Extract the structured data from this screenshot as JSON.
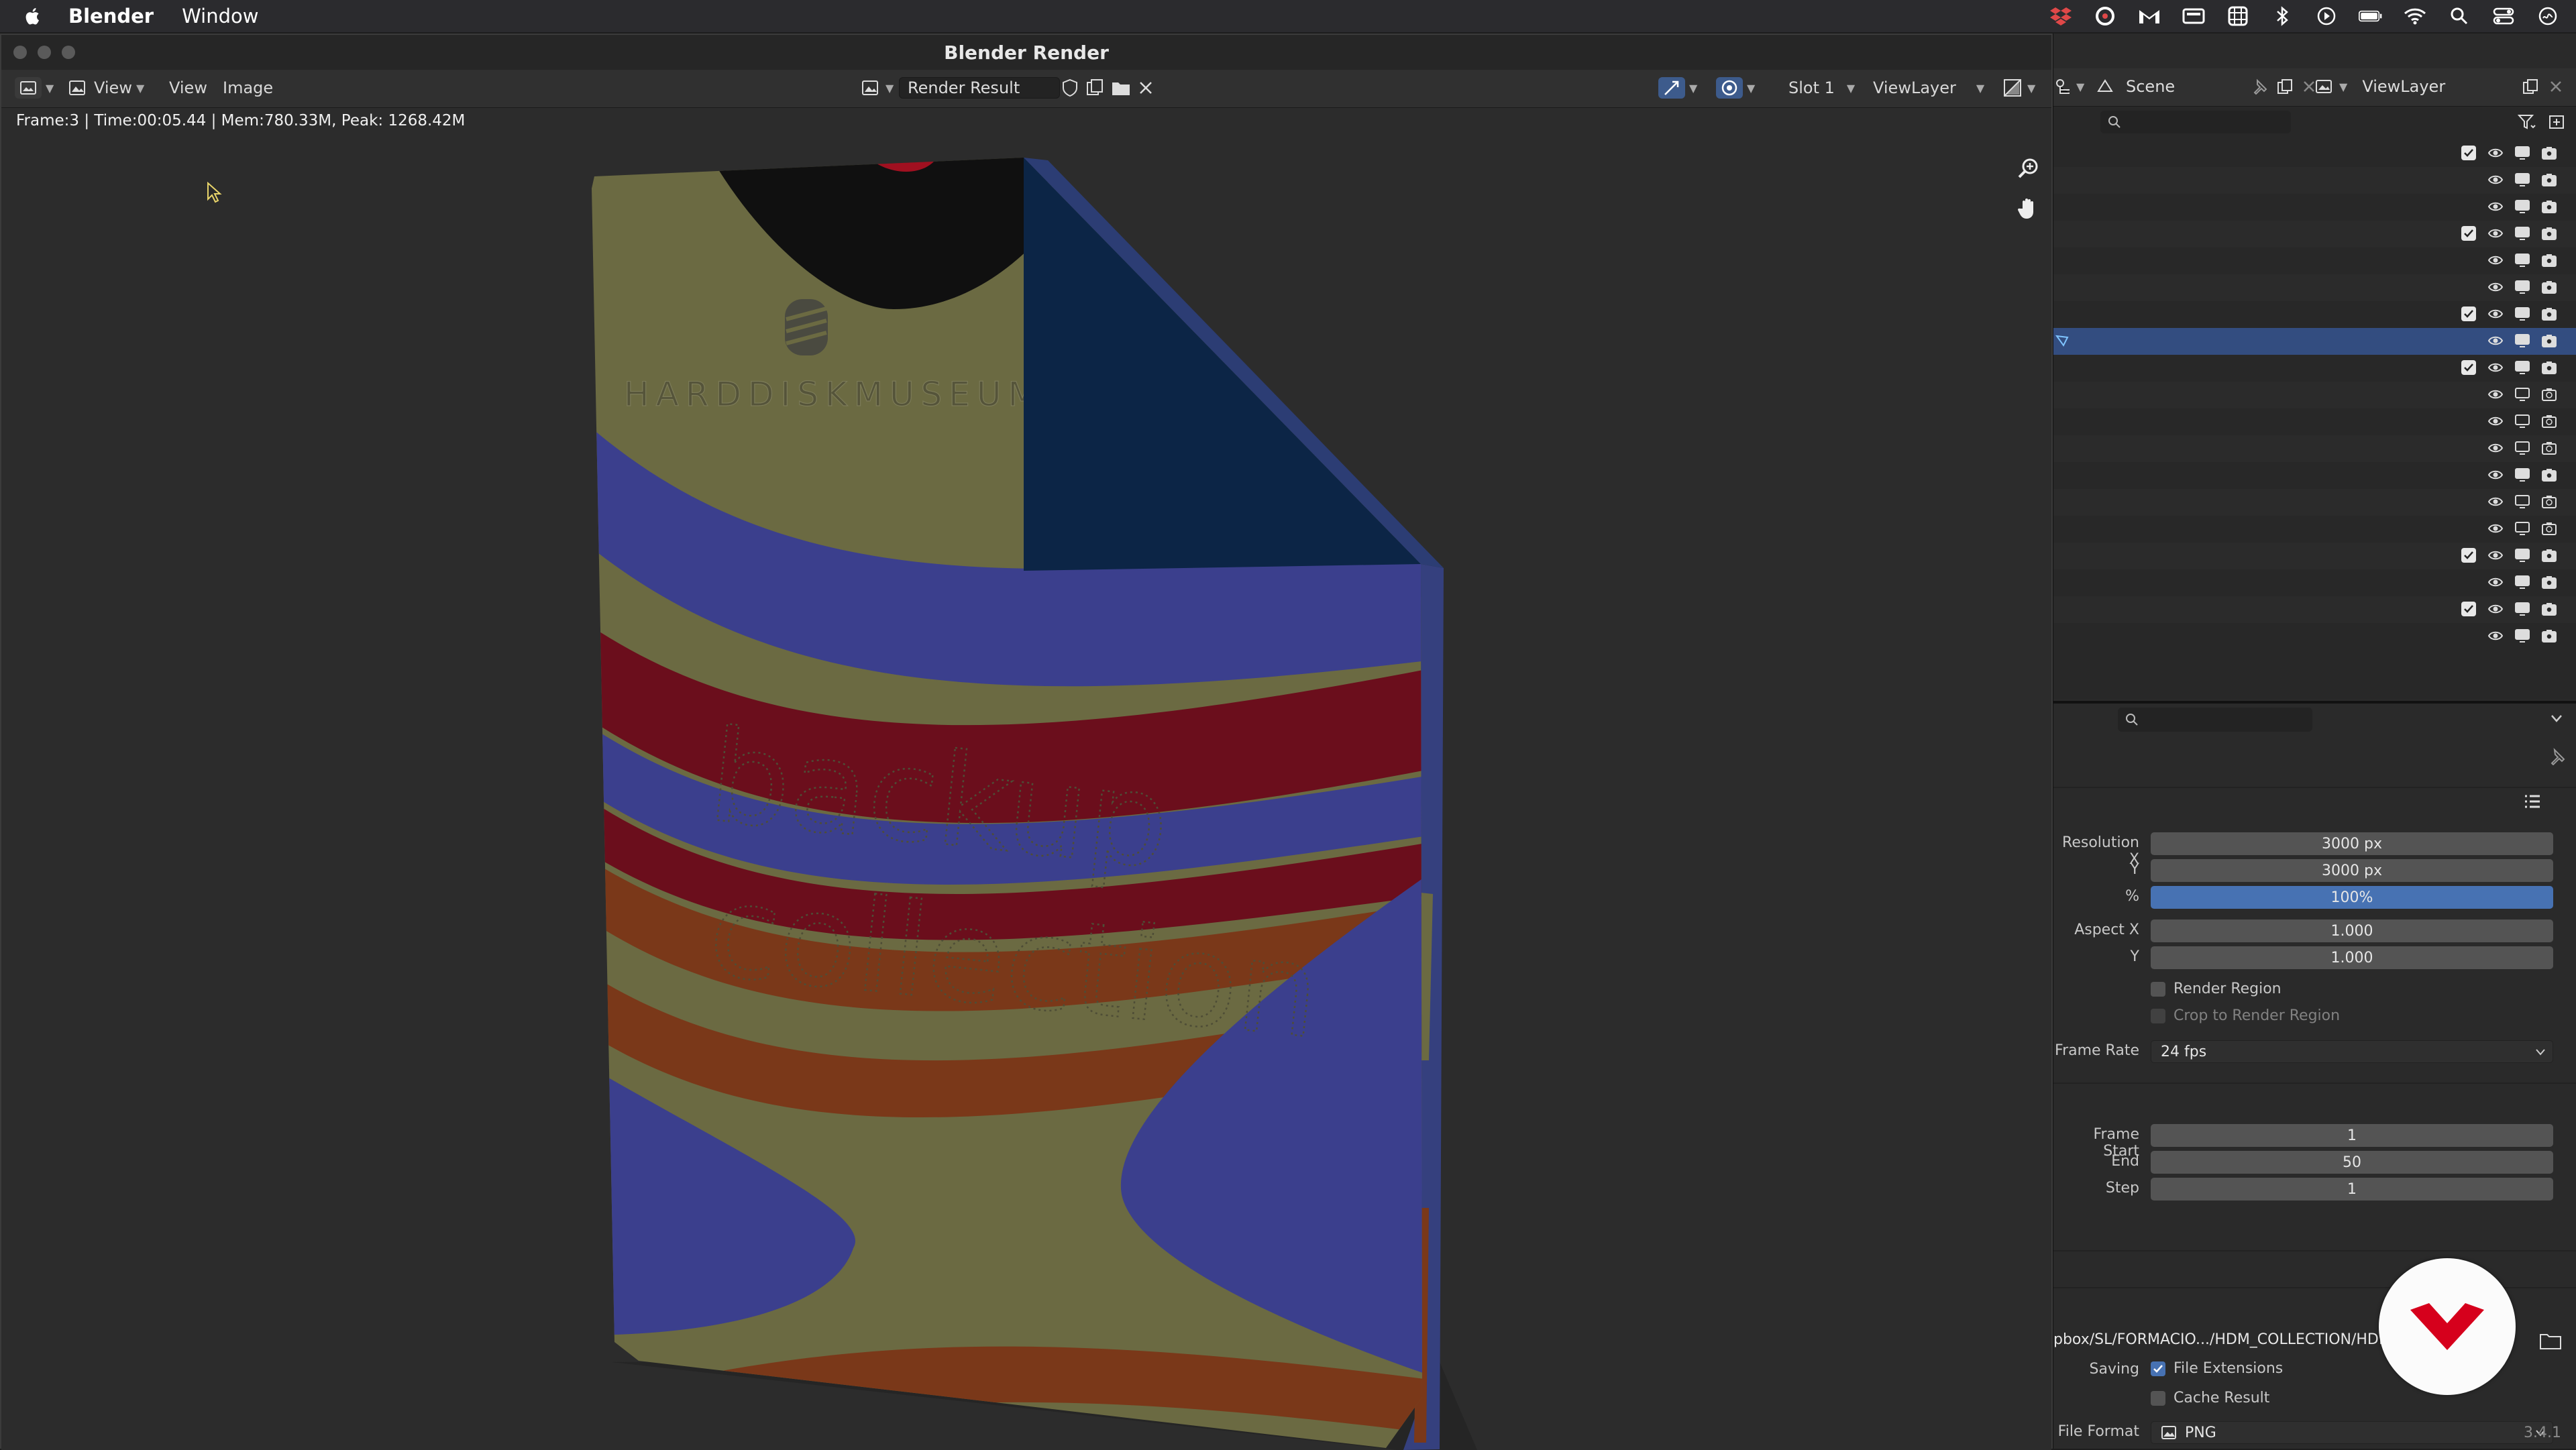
{
  "menubar": {
    "app_name": "Blender",
    "items": [
      "Window"
    ],
    "tray_icons": [
      "dropbox-icon",
      "creative-cloud-icon",
      "gmail-icon",
      "drive-icon",
      "grid-icon",
      "bluetooth-icon",
      "play-icon",
      "battery-icon",
      "wifi-icon",
      "search-icon",
      "control-center-icon",
      "siri-icon"
    ]
  },
  "window": {
    "title": "Blender Render"
  },
  "image_editor": {
    "menus": [
      "View",
      "View",
      "Image"
    ],
    "image_name": "Render Result",
    "slot": "Slot 1",
    "view_layer": "ViewLayer",
    "stats": "Frame:3 | Time:00:05.44 | Mem:780.33M, Peak: 1268.42M"
  },
  "render": {
    "brand_text": "HARDDISKMUSEUM",
    "line1": "backup",
    "line2": "collection",
    "colors": {
      "olive": "#6b6a42",
      "blue": "#3b3f8d",
      "red": "#6b0e1c",
      "orange": "#7a3819",
      "dark_blue": "#0c2546",
      "black": "#101010"
    }
  },
  "outliner": {
    "scene": "Scene",
    "view_layer": "ViewLayer",
    "rows": [
      {
        "checked": true,
        "selected": false,
        "dim": false
      },
      {
        "checked": false,
        "selected": false,
        "dim": false
      },
      {
        "checked": false,
        "selected": false,
        "dim": false
      },
      {
        "checked": true,
        "selected": false,
        "dim": false
      },
      {
        "checked": false,
        "selected": false,
        "dim": false
      },
      {
        "checked": false,
        "selected": false,
        "dim": false
      },
      {
        "checked": true,
        "selected": false,
        "dim": false
      },
      {
        "checked": false,
        "selected": true,
        "dim": false
      },
      {
        "checked": true,
        "selected": false,
        "dim": false
      },
      {
        "checked": false,
        "selected": false,
        "dim": true
      },
      {
        "checked": false,
        "selected": false,
        "dim": true
      },
      {
        "checked": false,
        "selected": false,
        "dim": true
      },
      {
        "checked": false,
        "selected": false,
        "dim": false
      },
      {
        "checked": false,
        "selected": false,
        "dim": true
      },
      {
        "checked": false,
        "selected": false,
        "dim": true
      },
      {
        "checked": true,
        "selected": false,
        "dim": false
      },
      {
        "checked": false,
        "selected": false,
        "dim": false
      },
      {
        "checked": true,
        "selected": false,
        "dim": false
      },
      {
        "checked": false,
        "selected": false,
        "dim": false
      }
    ]
  },
  "properties": {
    "resolution_x_label": "Resolution X",
    "resolution_x": "3000 px",
    "resolution_y_label": "Y",
    "resolution_y": "3000 px",
    "percent_label": "%",
    "percent": "100%",
    "aspect_x_label": "Aspect X",
    "aspect_x": "1.000",
    "aspect_y_label": "Y",
    "aspect_y": "1.000",
    "render_region": "Render Region",
    "crop_region": "Crop to Render Region",
    "frame_rate_label": "Frame Rate",
    "frame_rate": "24 fps",
    "frame_start_label": "Frame Start",
    "frame_start": "1",
    "end_label": "End",
    "end": "50",
    "step_label": "Step",
    "step": "1",
    "output_path": "pbox/SL/FORMACIO.../HDM_COLLECTION/HDM",
    "saving_label": "Saving",
    "file_extensions": "File Extensions",
    "cache_result": "Cache Result",
    "file_format_label": "File Format",
    "file_format": "PNG",
    "version": "3.4.1"
  }
}
